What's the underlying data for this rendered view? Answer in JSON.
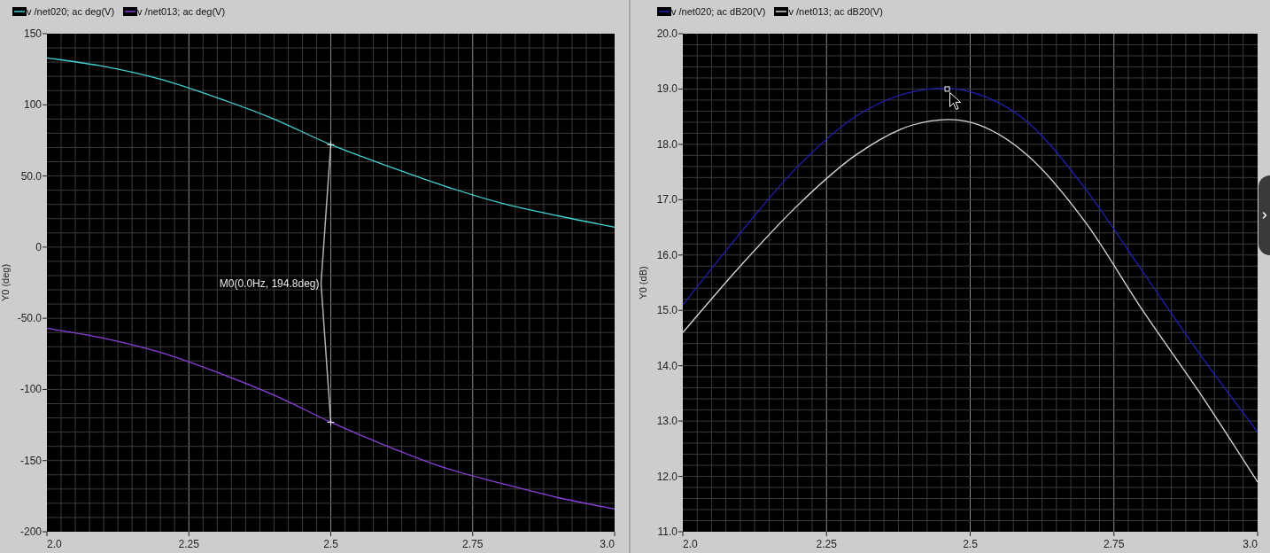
{
  "panels": [
    {
      "marker": {
        "label": "M0(0.0Hz, 194.8deg)"
      },
      "chart_data": {
        "type": "line",
        "grid": true,
        "ylabel": "Y0 (deg)",
        "x": [
          2.0,
          2.1,
          2.2,
          2.3,
          2.4,
          2.5,
          2.6,
          2.7,
          2.8,
          2.9,
          3.0
        ],
        "xlim": [
          2.0,
          3.0
        ],
        "ylim": [
          -200,
          150
        ],
        "xticks": [
          {
            "value": 2.0,
            "label": "2.0"
          },
          {
            "value": 2.25,
            "label": "2.25"
          },
          {
            "value": 2.5,
            "label": "2.5"
          },
          {
            "value": 2.75,
            "label": "2.75"
          },
          {
            "value": 3.0,
            "label": "3.0"
          }
        ],
        "yticks": [
          {
            "value": 150,
            "label": "150"
          },
          {
            "value": 100,
            "label": "100"
          },
          {
            "value": 50,
            "label": "50.0"
          },
          {
            "value": 0,
            "label": "0"
          },
          {
            "value": -50,
            "label": "-50.0"
          },
          {
            "value": -100,
            "label": "-100"
          },
          {
            "value": -150,
            "label": "-150"
          },
          {
            "value": -200,
            "label": "-200"
          }
        ],
        "series": [
          {
            "name": "v /net020; ac deg(V)",
            "color": "#40d0d0",
            "values": [
              133,
              127,
              118,
              105,
              90,
              72,
              57,
              43,
              31,
              22,
              14
            ]
          },
          {
            "name": "v /net013; ac deg(V)",
            "color": "#8a40d8",
            "values": [
              -57,
              -64,
              -74,
              -88,
              -104,
              -123,
              -140,
              -155,
              -166,
              -176,
              -184
            ]
          }
        ]
      }
    },
    {
      "pointer_marker": true,
      "chart_data": {
        "type": "line",
        "grid": true,
        "ylabel": "Y0 (dB)",
        "x": [
          2.0,
          2.1,
          2.2,
          2.3,
          2.4,
          2.5,
          2.6,
          2.7,
          2.8,
          2.9,
          3.0
        ],
        "xlim": [
          2.0,
          3.0
        ],
        "ylim": [
          11,
          20
        ],
        "xticks": [
          {
            "value": 2.0,
            "label": "2.0"
          },
          {
            "value": 2.25,
            "label": "2.25"
          },
          {
            "value": 2.5,
            "label": "2.5"
          },
          {
            "value": 2.75,
            "label": "2.75"
          },
          {
            "value": 3.0,
            "label": "3.0"
          }
        ],
        "yticks": [
          {
            "value": 11,
            "label": "11.0"
          },
          {
            "value": 12,
            "label": "12.0"
          },
          {
            "value": 13,
            "label": "13.0"
          },
          {
            "value": 14,
            "label": "14.0"
          },
          {
            "value": 15,
            "label": "15.0"
          },
          {
            "value": 16,
            "label": "16.0"
          },
          {
            "value": 17,
            "label": "17.0"
          },
          {
            "value": 18,
            "label": "18.0"
          },
          {
            "value": 19,
            "label": "19.0"
          },
          {
            "value": 20,
            "label": "20.0"
          }
        ],
        "series": [
          {
            "name": "v /net020; ac dB20(V)",
            "color": "#2020b0",
            "values": [
              15.1,
              16.4,
              17.6,
              18.5,
              18.95,
              18.95,
              18.4,
              17.2,
              15.7,
              14.2,
              12.8
            ]
          },
          {
            "name": "v /net013; ac dB20(V)",
            "color": "#d8d8d8",
            "values": [
              14.6,
              15.8,
              16.9,
              17.8,
              18.35,
              18.4,
              17.8,
              16.6,
              15.0,
              13.5,
              11.9
            ]
          }
        ]
      }
    }
  ]
}
